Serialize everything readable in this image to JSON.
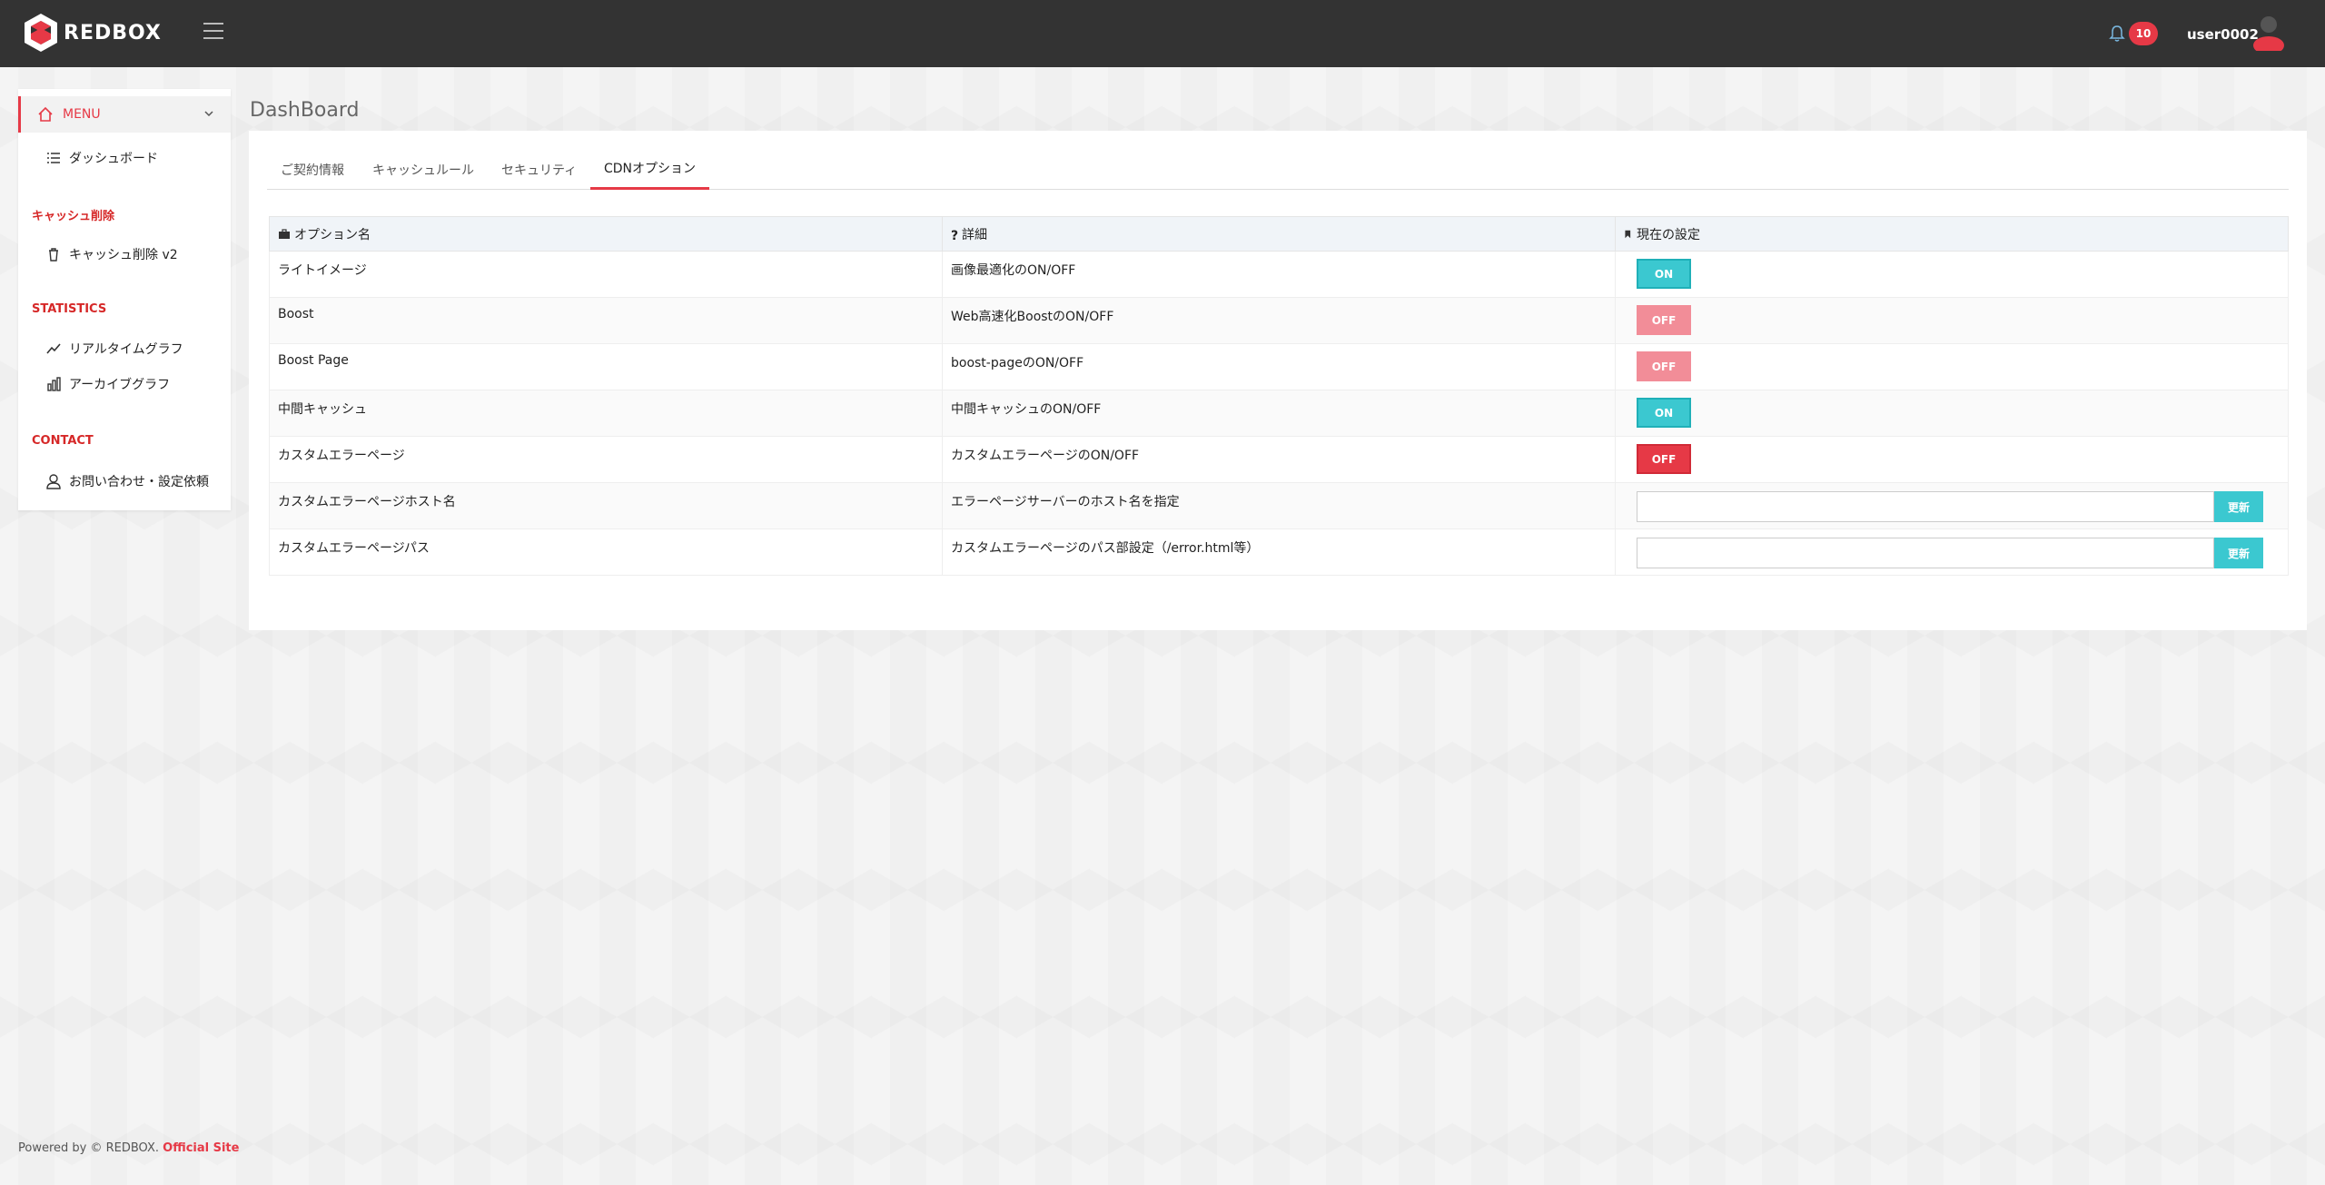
{
  "colors": {
    "accent": "#e63946",
    "topbar": "#333333",
    "on": "#3bc8d0",
    "off_light": "#f28d98",
    "off_dark": "#e63946"
  },
  "header": {
    "brand": "REDBOX",
    "notifications_count": "10",
    "username": "user0002"
  },
  "sidebar": {
    "menu_label": "MENU",
    "dashboard_label": "ダッシュボード",
    "sections": [
      {
        "title": "キャッシュ削除",
        "items": [
          {
            "label": "キャッシュ削除 v2",
            "icon": "trash-icon"
          }
        ]
      },
      {
        "title": "STATISTICS",
        "items": [
          {
            "label": "リアルタイムグラフ",
            "icon": "line-chart-icon"
          },
          {
            "label": "アーカイブグラフ",
            "icon": "bar-chart-icon"
          }
        ]
      },
      {
        "title": "CONTACT",
        "items": [
          {
            "label": "お問い合わせ・設定依頼",
            "icon": "user-icon"
          }
        ]
      }
    ]
  },
  "main": {
    "page_title": "DashBoard",
    "tabs": [
      {
        "label": "ご契約情報",
        "active": false
      },
      {
        "label": "キャッシュルール",
        "active": false
      },
      {
        "label": "セキュリティ",
        "active": false
      },
      {
        "label": "CDNオプション",
        "active": true
      }
    ],
    "table": {
      "headers": [
        "オプション名",
        "詳細",
        "現在の設定"
      ],
      "rows": [
        {
          "name": "ライトイメージ",
          "detail": "画像最適化のON/OFF",
          "setting": "ON"
        },
        {
          "name": "Boost",
          "detail": "Web高速化BoostのON/OFF",
          "setting": "OFF"
        },
        {
          "name": "Boost Page",
          "detail": "boost-pageのON/OFF",
          "setting": "OFF"
        },
        {
          "name": "中間キャッシュ",
          "detail": "中間キャッシュのON/OFF",
          "setting": "ON"
        },
        {
          "name": "カスタムエラーページ",
          "detail": "カスタムエラーページのON/OFF",
          "setting": "OFF"
        },
        {
          "name": "カスタムエラーページホスト名",
          "detail": "エラーページサーバーのホスト名を指定",
          "input_value": "",
          "button": "更新"
        },
        {
          "name": "カスタムエラーページパス",
          "detail": "カスタムエラーページのパス部設定（/error.html等）",
          "input_value": "",
          "button": "更新"
        }
      ]
    }
  },
  "footer": {
    "text": "Powered by © REDBOX. ",
    "link": "Official Site"
  }
}
